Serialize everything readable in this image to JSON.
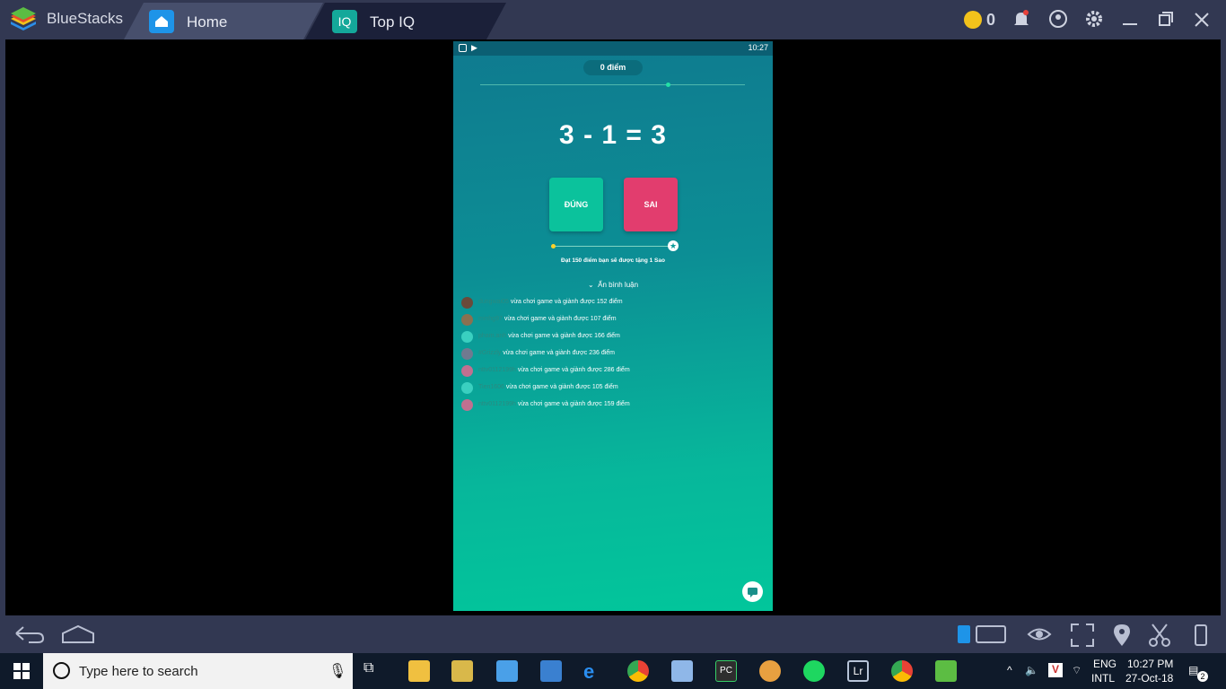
{
  "window": {
    "brand": "BlueStacks",
    "tabs": [
      {
        "label": "Home",
        "icon": "home-icon"
      },
      {
        "label": "Top IQ",
        "icon": "iq-icon",
        "icon_text": "IQ"
      }
    ],
    "coins": "0"
  },
  "device": {
    "time": "10:27",
    "score": "0 điểm",
    "equation": "3 - 1 = 3",
    "answer_true": "ĐÚNG",
    "answer_false": "SAI",
    "star_hint": "Đạt 150 điểm bạn sẽ được tặng 1 Sao",
    "toggle_comments": "Ẩn bình luận",
    "feed": [
      {
        "user": "dungwai05",
        "msg": "vừa chơi game và giành được 152 điểm",
        "avatar_color": "#6a4a3a"
      },
      {
        "user": "minhg97",
        "msg": "vừa chơi game và giành được 107 điểm",
        "avatar_color": "#8a7050"
      },
      {
        "user": "pham.anh",
        "msg": "vừa chơi game và giành được 166 điểm",
        "avatar_color": "#3ad0c0"
      },
      {
        "user": "#Grizzly",
        "msg": "vừa chơi game và giành được 236 điểm",
        "avatar_color": "#707a90"
      },
      {
        "user": "nttv0112199h",
        "msg": "vừa chơi game và giành được 286 điểm",
        "avatar_color": "#c07090"
      },
      {
        "user": "Tien1606",
        "msg": "vừa chơi game và giành được 105 điểm",
        "avatar_color": "#3ad0c0"
      },
      {
        "user": "nttv0112199h",
        "msg": "vừa chơi game và giành được 159 điểm",
        "avatar_color": "#c07090"
      }
    ]
  },
  "taskbar": {
    "search_placeholder": "Type here to search",
    "lang_top": "ENG",
    "lang_bottom": "INTL",
    "time": "10:27 PM",
    "date": "27-Oct-18",
    "notification_count": "2"
  },
  "colors": {
    "titlebar": "#323852",
    "accent_true": "#0bc29c",
    "accent_false": "#e23d6e"
  }
}
